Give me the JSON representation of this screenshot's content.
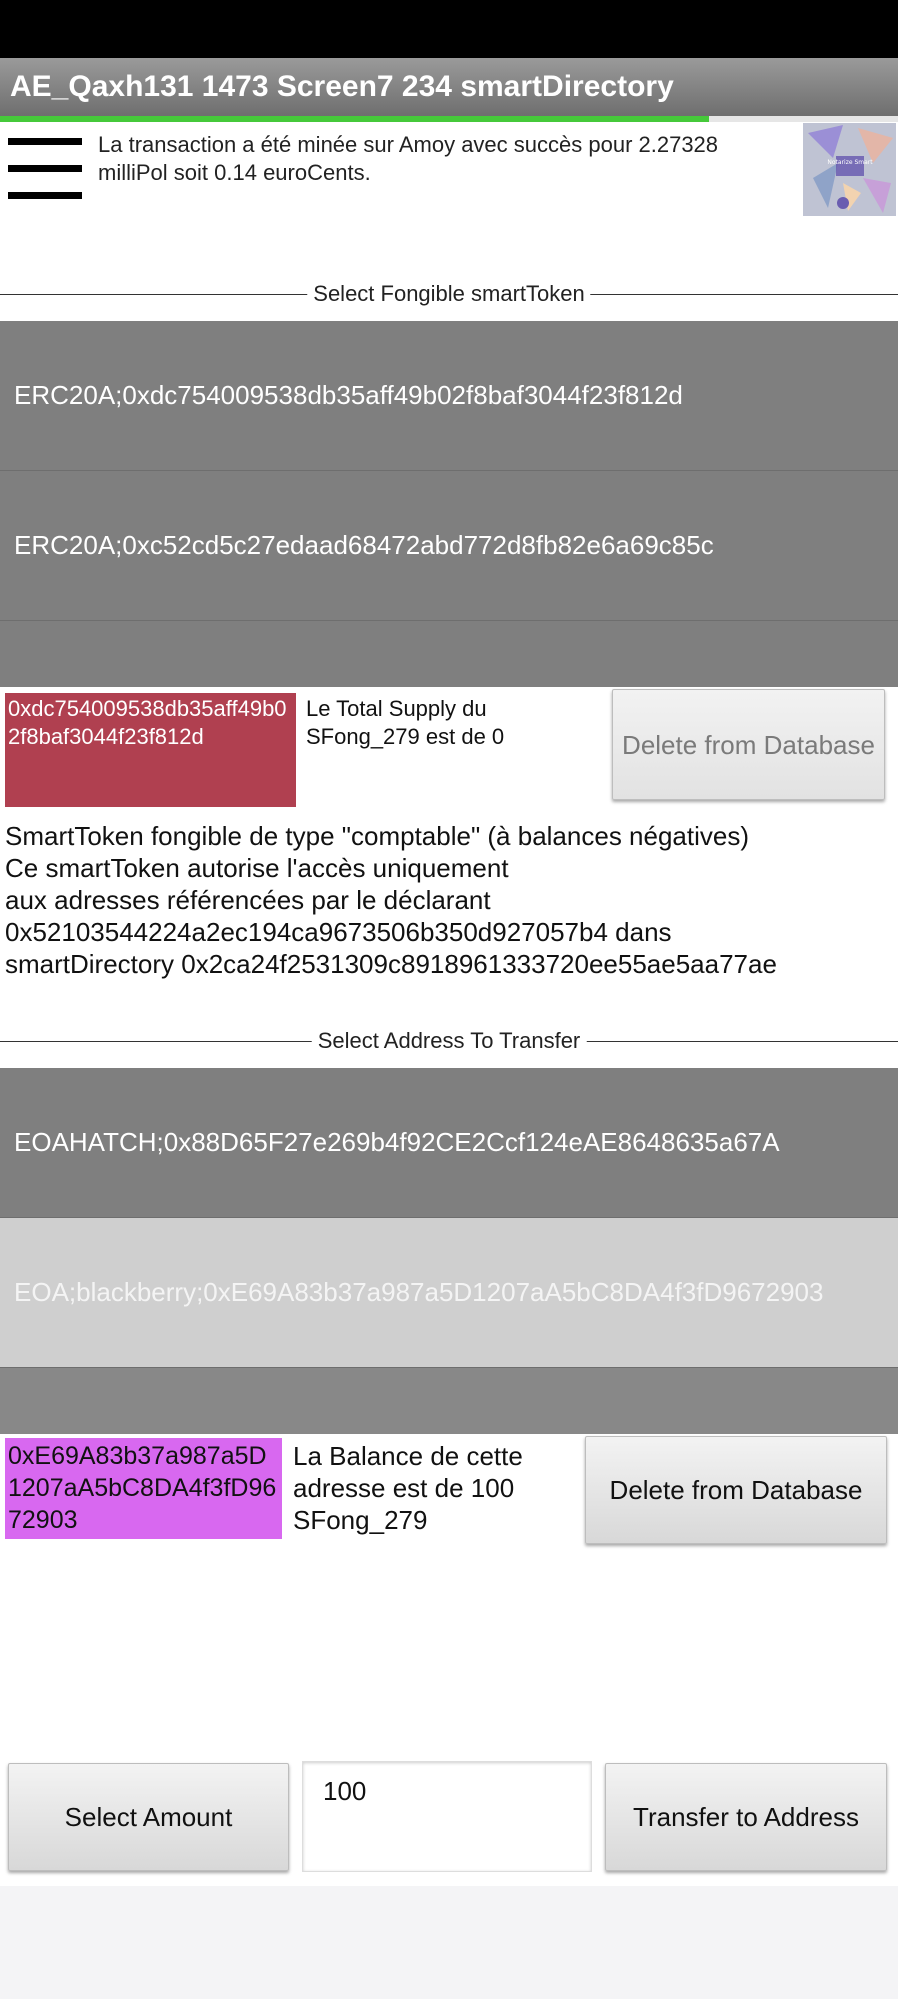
{
  "app": {
    "title": "AE_Qaxh131 1473 Screen7 234 smartDirectory",
    "progress": 0.79,
    "accent_color": "#46c93a"
  },
  "header": {
    "menu_icon": "hamburger-menu-icon",
    "notice": "La transaction a été minée sur Amoy avec succès pour 2.27328 milliPol soit 0.14 euroCents.",
    "thumbnail_icon": "app-logo-thumbnail",
    "thumbnail_text": "Notarize Smart"
  },
  "token_section": {
    "title": "Select Fongible smartToken",
    "items": [
      "ERC20A;0xdc754009538db35aff49b02f8baf3044f23f812d",
      "ERC20A;0xc52cd5c27edaad68472abd772d8fb82e6a69c85c"
    ],
    "selected_address": "0xdc754009538db35aff49b02f8baf3044f23f812d",
    "selected_color": "#b04050",
    "supply_text": "Le Total Supply du SFong_279 est de 0",
    "delete_label": "Delete from Database"
  },
  "description": {
    "lines": [
      "SmartToken fongible de type \"comptable\" (à balances négatives)",
      "Ce smartToken autorise l'accès uniquement",
      "aux adresses référencées par le déclarant",
      "0x52103544224a2ec194ca9673506b350d927057b4 dans",
      "smartDirectory 0x2ca24f2531309c8918961333720ee55ae5aa77ae"
    ]
  },
  "address_section": {
    "title": "Select Address To Transfer",
    "items": [
      "EOAHATCH;0x88D65F27e269b4f92CE2Ccf124eAE8648635a67A",
      "EOA;blackberry;0xE69A83b37a987a5D1207aA5bC8DA4f3fD9672903"
    ],
    "selected_address": "0xE69A83b37a987a5D1207aA5bC8DA4f3fD9672903",
    "selected_color": "#d868f0",
    "balance_text": "La Balance de cette adresse est de 100 SFong_279",
    "delete_label": "Delete from Database"
  },
  "transfer": {
    "select_amount_label": "Select Amount",
    "amount_value": "100",
    "transfer_label": "Transfer to Address"
  }
}
